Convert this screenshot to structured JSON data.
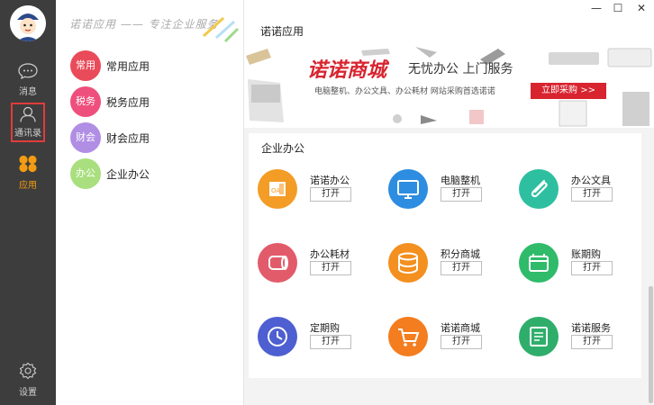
{
  "nav": {
    "messages": "消息",
    "contacts": "通讯录",
    "apps": "应用",
    "settings": "设置"
  },
  "sidebar": {
    "slogan": "诺诺应用 —— 专注企业服务",
    "categories": [
      {
        "badge": "常用",
        "label": "常用应用",
        "color": "#e94b5a"
      },
      {
        "badge": "税务",
        "label": "税务应用",
        "color": "#ef4f7d"
      },
      {
        "badge": "财会",
        "label": "财会应用",
        "color": "#b08ee4"
      },
      {
        "badge": "办公",
        "label": "企业办公",
        "color": "#a9df7e"
      }
    ]
  },
  "header": {
    "title": "诺诺应用",
    "minimize": "—",
    "maximize": "☐",
    "close": "✕"
  },
  "banner": {
    "brand": "诺诺商城",
    "tagline": "无忧办公  上门服务",
    "subline": "电脑整机、办公文具、办公耗材 网站采购首选诺诺",
    "cta": "立即采购 >>"
  },
  "section": {
    "title": "企业办公",
    "open_label": "打开",
    "apps": [
      {
        "name": "诺诺办公",
        "color": "#f39c26",
        "icon": "oa-icon"
      },
      {
        "name": "电脑整机",
        "color": "#2d8de0",
        "icon": "monitor-icon"
      },
      {
        "name": "办公文具",
        "color": "#2ebfa0",
        "icon": "paperclip-icon"
      },
      {
        "name": "办公耗材",
        "color": "#e25b6b",
        "icon": "paper-roll-icon"
      },
      {
        "name": "积分商城",
        "color": "#f3901f",
        "icon": "coins-icon"
      },
      {
        "name": "账期购",
        "color": "#2fbb6a",
        "icon": "wallet-icon"
      },
      {
        "name": "定期购",
        "color": "#4e5fd1",
        "icon": "clock-icon"
      },
      {
        "name": "诺诺商城",
        "color": "#f37d1f",
        "icon": "cart-icon"
      },
      {
        "name": "诺诺服务",
        "color": "#2fae6b",
        "icon": "service-doc-icon"
      }
    ]
  }
}
